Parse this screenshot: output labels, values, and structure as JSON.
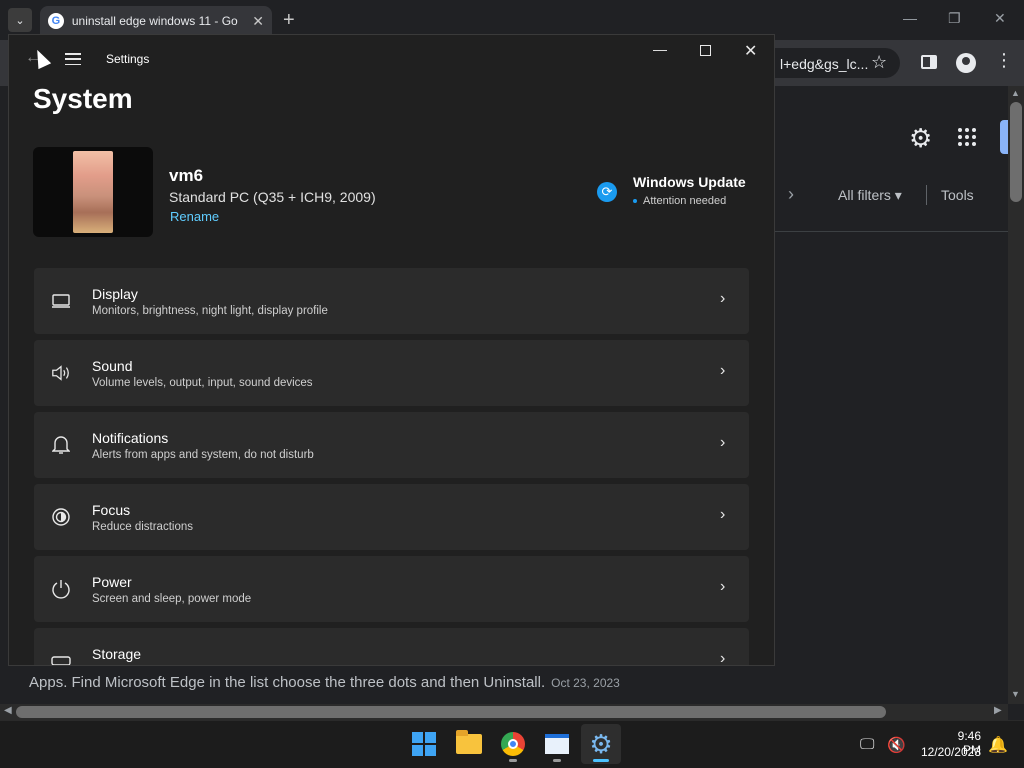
{
  "browser": {
    "tab_title": "uninstall edge windows 11 - Go",
    "tab_close": "✕",
    "new_tab": "+",
    "favicon": "G",
    "address_partial": "l+edg&gs_lc...",
    "icons": [
      "tab-search-icon",
      "google-favicon",
      "star-icon",
      "side-panel-icon",
      "profile-icon",
      "more-menu-icon"
    ],
    "win_minimize": "—",
    "win_restore": "❐",
    "win_close": "✕",
    "filters": {
      "all_filters": "All filters ▾",
      "tools": "Tools"
    },
    "snippet": "Apps. Find Microsoft Edge in the list choose the three dots and then Uninstall.",
    "snippet_date": "Oct 23, 2023"
  },
  "settings": {
    "app_title": "Settings",
    "page_title": "System",
    "device": {
      "name": "vm6",
      "model": "Standard PC (Q35 + ICH9, 2009)",
      "rename": "Rename"
    },
    "windows_update": {
      "title": "Windows Update",
      "status": "Attention needed"
    },
    "items": [
      {
        "label": "Display",
        "sub": "Monitors, brightness, night light, display profile",
        "icon": "display-icon"
      },
      {
        "label": "Sound",
        "sub": "Volume levels, output, input, sound devices",
        "icon": "sound-icon"
      },
      {
        "label": "Notifications",
        "sub": "Alerts from apps and system, do not disturb",
        "icon": "bell-icon"
      },
      {
        "label": "Focus",
        "sub": "Reduce distractions",
        "icon": "focus-icon"
      },
      {
        "label": "Power",
        "sub": "Screen and sleep, power mode",
        "icon": "power-icon"
      },
      {
        "label": "Storage",
        "sub": "",
        "icon": "storage-icon"
      }
    ]
  },
  "taskbar": {
    "apps": [
      "start",
      "file-explorer",
      "chrome",
      "app",
      "settings"
    ],
    "time": "9:46 PM",
    "date": "12/20/2023"
  },
  "colors": {
    "accent": "#60cdff",
    "update_blue": "#1a9bf0",
    "window_bg": "#202020",
    "card_bg": "#2b2b2b"
  }
}
